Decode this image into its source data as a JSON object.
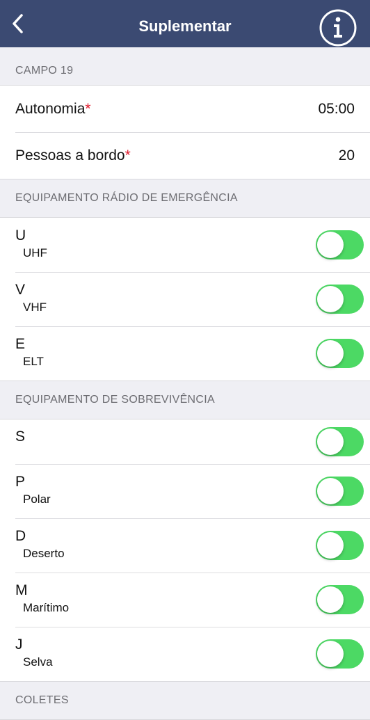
{
  "nav": {
    "title": "Suplementar",
    "back_icon": "chevron-left-icon",
    "info_icon": "info-circle-icon"
  },
  "colors": {
    "nav_bg": "#3b4a72",
    "toggle_on": "#4cd964",
    "required": "#e0192b"
  },
  "campo19": {
    "header": "CAMPO 19",
    "autonomia": {
      "label": "Autonomia",
      "required": "*",
      "value": "05:00"
    },
    "pessoas": {
      "label": "Pessoas a bordo",
      "required": "*",
      "value": "20"
    }
  },
  "radio": {
    "header": "EQUIPAMENTO RÁDIO DE EMERGÊNCIA",
    "items": [
      {
        "code": "U",
        "desc": "UHF",
        "on": true
      },
      {
        "code": "V",
        "desc": "VHF",
        "on": true
      },
      {
        "code": "E",
        "desc": "ELT",
        "on": true
      }
    ]
  },
  "sobrevivencia": {
    "header": "EQUIPAMENTO DE SOBREVIVÊNCIA",
    "items": [
      {
        "code": "S",
        "desc": "",
        "on": true
      },
      {
        "code": "P",
        "desc": "Polar",
        "on": true
      },
      {
        "code": "D",
        "desc": "Deserto",
        "on": true
      },
      {
        "code": "M",
        "desc": "Marítimo",
        "on": true
      },
      {
        "code": "J",
        "desc": "Selva",
        "on": true
      }
    ]
  },
  "coletes": {
    "header": "COLETES"
  }
}
